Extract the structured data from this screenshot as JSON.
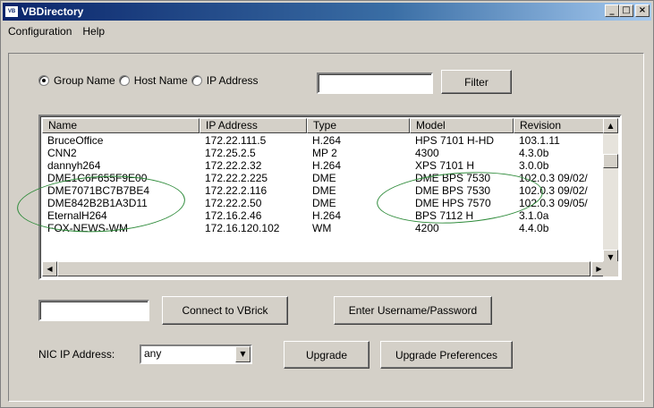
{
  "window": {
    "title": "VBDirectory",
    "icon": "vbrick-app-icon"
  },
  "title_buttons": {
    "minimize": "_",
    "maximize": "□",
    "close": "×"
  },
  "menu": [
    "Configuration",
    "Help"
  ],
  "search": {
    "options": [
      {
        "label": "Group Name",
        "checked": true
      },
      {
        "label": "Host Name",
        "checked": false
      },
      {
        "label": "IP Address",
        "checked": false
      }
    ],
    "value": "",
    "filter_label": "Filter"
  },
  "table": {
    "columns": [
      "Name",
      "IP Address",
      "Type",
      "Model",
      "Revision"
    ],
    "rows": [
      {
        "name": "BruceOffice",
        "ip": "172.22.111.5",
        "type": "H.264",
        "model": "HPS 7101 H-HD",
        "revision": "103.1.11"
      },
      {
        "name": "CNN2",
        "ip": "172.25.2.5",
        "type": "MP 2",
        "model": "4300",
        "revision": "4.3.0b"
      },
      {
        "name": "dannyh264",
        "ip": "172.22.2.32",
        "type": "H.264",
        "model": "XPS 7101 H",
        "revision": "3.0.0b"
      },
      {
        "name": "DME1C6F655F9E00",
        "ip": "172.22.2.225",
        "type": "DME",
        "model": "DME BPS 7530",
        "revision": "102.0.3 09/02/"
      },
      {
        "name": "DME7071BC7B7BE4",
        "ip": "172.22.2.116",
        "type": "DME",
        "model": "DME BPS 7530",
        "revision": "102.0.3 09/02/"
      },
      {
        "name": "DME842B2B1A3D11",
        "ip": "172.22.2.50",
        "type": "DME",
        "model": "DME HPS 7570",
        "revision": "102.0.3 09/05/"
      },
      {
        "name": "EternalH264",
        "ip": "172.16.2.46",
        "type": "H.264",
        "model": "BPS 7112 H",
        "revision": "3.1.0a"
      },
      {
        "name": "FOX-NEWS-WM",
        "ip": "172.16.120.102",
        "type": "WM",
        "model": "4200",
        "revision": "4.4.0b"
      }
    ]
  },
  "connect": {
    "value": "",
    "button_label": "Connect to VBrick"
  },
  "credentials_label": "Enter Username/Password",
  "nic": {
    "label": "NIC IP Address:",
    "selected": "any"
  },
  "upgrade_label": "Upgrade",
  "upgrade_prefs_label": "Upgrade Preferences",
  "icons": {
    "scroll_up": "▲",
    "scroll_down": "▼",
    "scroll_left": "◀",
    "scroll_right": "▶",
    "dropdown": "▼"
  },
  "colors": {
    "title_gradient_start": "#0a246a",
    "annotation": "#2e8b3a",
    "window_bg": "#d4d0c8"
  }
}
